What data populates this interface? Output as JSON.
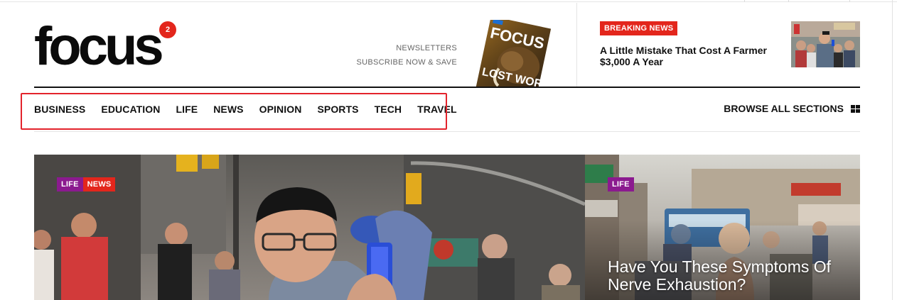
{
  "brand": {
    "logo_text": "focus",
    "badge_count": "2",
    "accent": "#e3261c"
  },
  "promo": {
    "newsletters": "NEWSLETTERS",
    "subscribe": "SUBSCRIBE NOW & SAVE",
    "magazine_masthead": "FOCUS",
    "magazine_cover_text": "LOST WORLD"
  },
  "breaking": {
    "badge": "BREAKING NEWS",
    "title": "A Little Mistake That Cost A Farmer $3,000 A Year"
  },
  "nav": {
    "items": [
      {
        "label": "BUSINESS"
      },
      {
        "label": "EDUCATION"
      },
      {
        "label": "LIFE"
      },
      {
        "label": "NEWS"
      },
      {
        "label": "OPINION"
      },
      {
        "label": "SPORTS"
      },
      {
        "label": "TECH"
      },
      {
        "label": "TRAVEL"
      }
    ],
    "browse_label": "BROWSE ALL SECTIONS",
    "browse_icon": "grid-icon"
  },
  "featured": {
    "tags": [
      "LIFE",
      "NEWS"
    ],
    "tag_colors": {
      "LIFE": "#8b1a8f",
      "NEWS": "#e3261c"
    }
  },
  "side_story": {
    "tag": "LIFE",
    "title": "Have You These Symptoms Of Nerve Exhaustion?"
  }
}
